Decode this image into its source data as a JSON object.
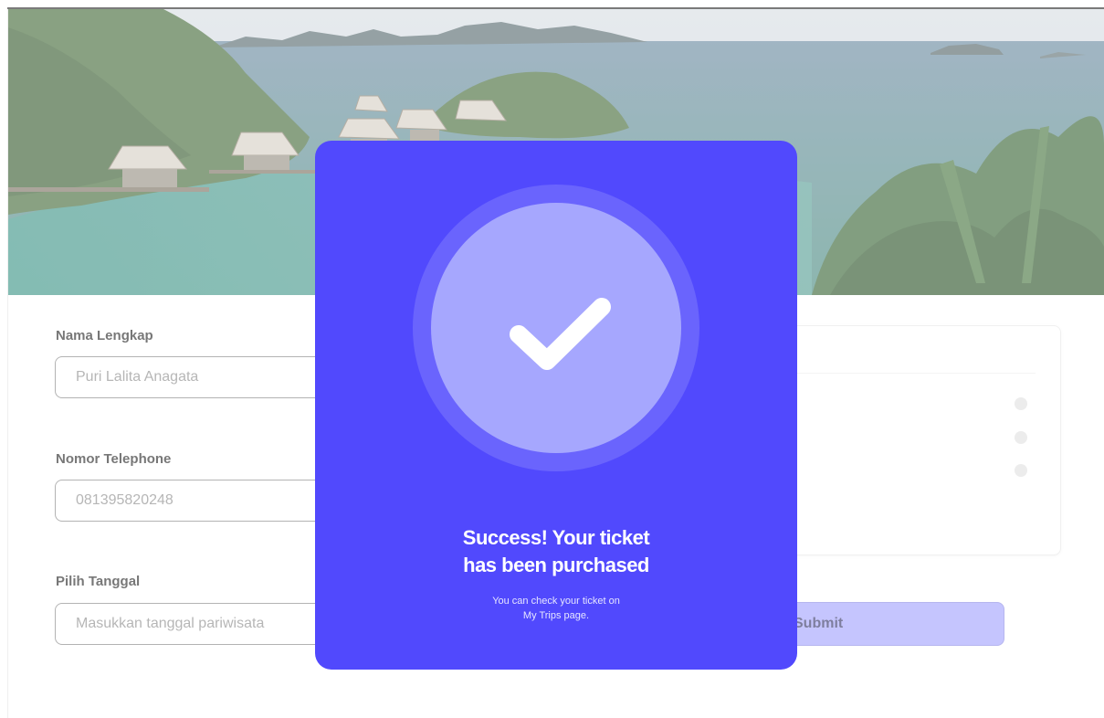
{
  "form": {
    "name_label": "Nama Lengkap",
    "name_value": "Puri Lalita Anagata",
    "phone_label": "Nomor Telephone",
    "phone_value": "081395820248",
    "date_label": "Pilih Tanggal",
    "date_placeholder": "Masukkan tanggal pariwisata"
  },
  "submit_label": "Submit",
  "modal": {
    "title_line1": "Success! Your ticket",
    "title_line2": "has been purchased",
    "subtitle_line1": "You can check your ticket on",
    "subtitle_line2": "My Trips page."
  },
  "colors": {
    "modal_bg": "#5149fd",
    "check_circle": "#a6a7fe",
    "submit_bg": "#a6a6fe"
  }
}
